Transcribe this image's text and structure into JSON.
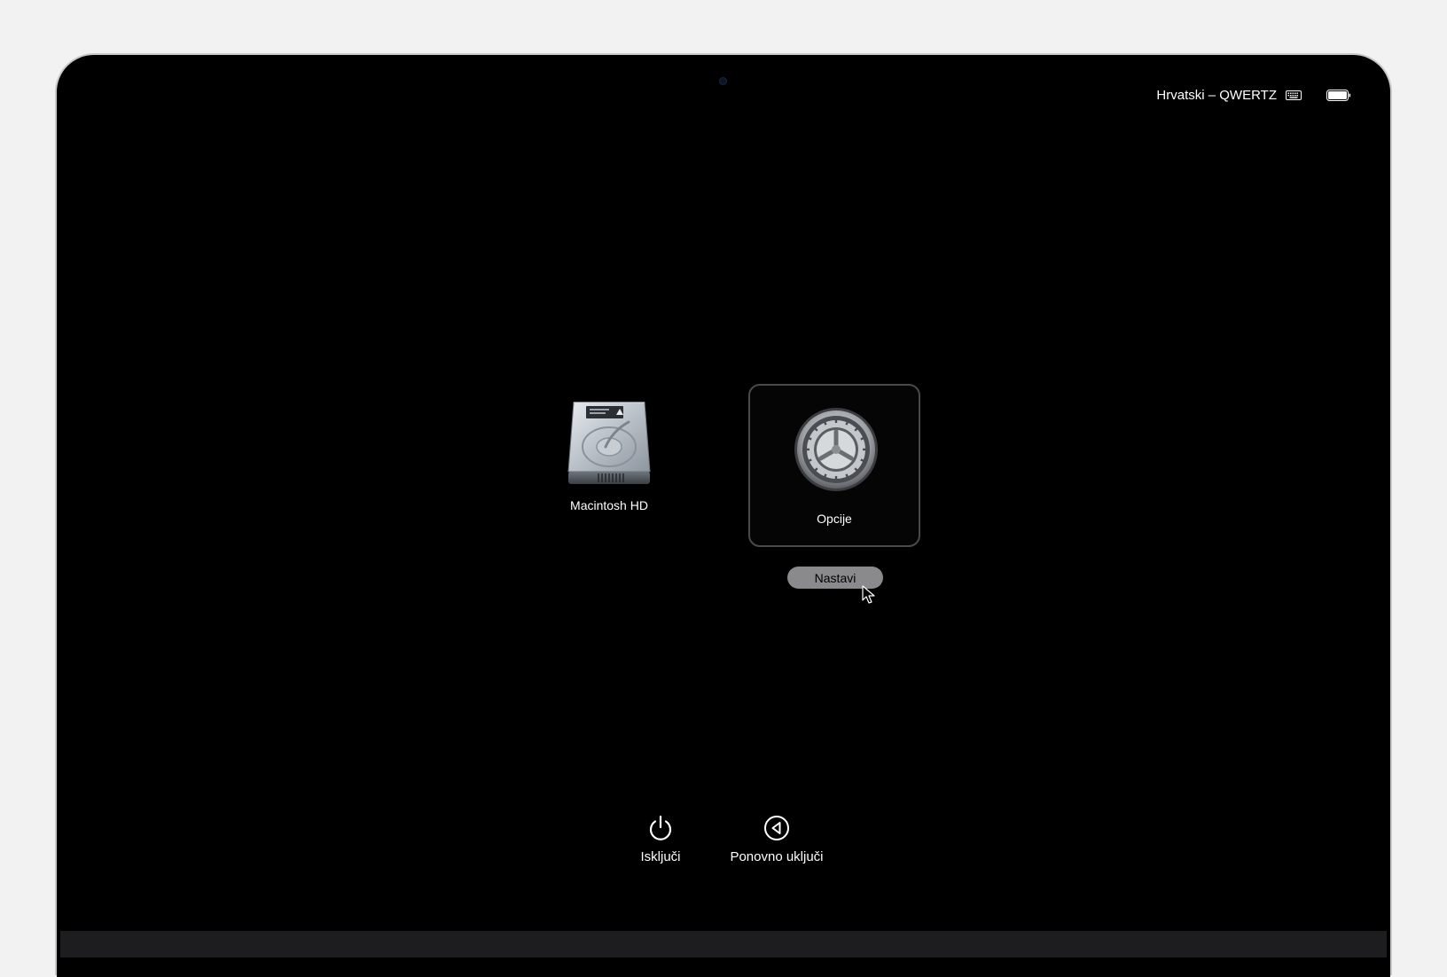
{
  "status_bar": {
    "keyboard_layout": "Hrvatski – QWERTZ",
    "keyboard_icon": "keyboard-icon",
    "battery_icon": "battery-icon"
  },
  "startup_items": [
    {
      "label": "Macintosh HD",
      "icon": "hard-drive-icon",
      "selected": false
    },
    {
      "label": "Opcije",
      "icon": "gear-icon",
      "selected": true
    }
  ],
  "continue_button": {
    "label": "Nastavi"
  },
  "actions": {
    "shutdown": {
      "label": "Isključi",
      "icon": "power-icon"
    },
    "restart": {
      "label": "Ponovno uključi",
      "icon": "restart-icon"
    }
  },
  "colors": {
    "screen": "#000000",
    "frame": "#c9c9cb",
    "background": "#f2f2f2",
    "button": "#8a8a8c",
    "selection_border": "#4a4a4c"
  }
}
